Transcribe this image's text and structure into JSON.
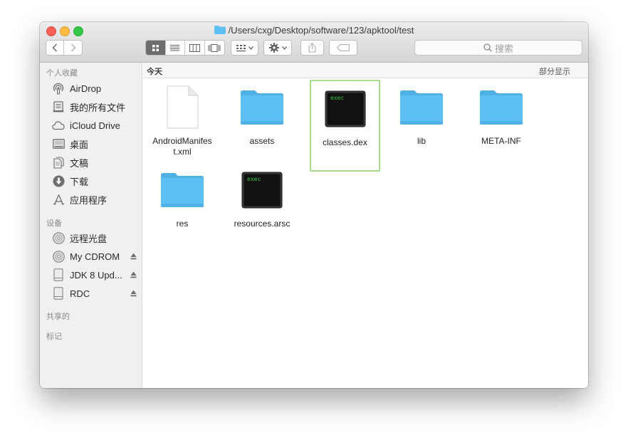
{
  "window": {
    "title": "/Users/cxg/Desktop/software/123/apktool/test"
  },
  "toolbar": {
    "search_placeholder": "搜索"
  },
  "sidebar": {
    "favorites_header": "个人收藏",
    "favorites": [
      {
        "label": "AirDrop",
        "icon": "airdrop-icon"
      },
      {
        "label": "我的所有文件",
        "icon": "all-files-icon"
      },
      {
        "label": "iCloud Drive",
        "icon": "cloud-icon"
      },
      {
        "label": "桌面",
        "icon": "desktop-icon"
      },
      {
        "label": "文稿",
        "icon": "documents-icon"
      },
      {
        "label": "下载",
        "icon": "download-icon"
      },
      {
        "label": "应用程序",
        "icon": "applications-icon"
      }
    ],
    "devices_header": "设备",
    "devices": [
      {
        "label": "远程光盘",
        "icon": "disc-icon"
      },
      {
        "label": "My CDROM",
        "icon": "disc-icon"
      },
      {
        "label": "JDK 8 Upd...",
        "icon": "drive-icon"
      },
      {
        "label": "RDC",
        "icon": "drive-icon"
      }
    ],
    "shared_header": "共享的",
    "tags_header": "标记"
  },
  "content": {
    "section_label": "今天",
    "show_less": "部分显示",
    "files": [
      {
        "name": "AndroidManifest.xml",
        "kind": "document"
      },
      {
        "name": "assets",
        "kind": "folder"
      },
      {
        "name": "classes.dex",
        "kind": "exec",
        "selected": true
      },
      {
        "name": "lib",
        "kind": "folder"
      },
      {
        "name": "META-INF",
        "kind": "folder"
      },
      {
        "name": "res",
        "kind": "folder"
      },
      {
        "name": "resources.arsc",
        "kind": "exec"
      }
    ],
    "exec_label": "exec"
  },
  "colors": {
    "folder": "#5ec0f2",
    "selection_border": "#a6dc8a",
    "exec_text": "#35c23a"
  }
}
